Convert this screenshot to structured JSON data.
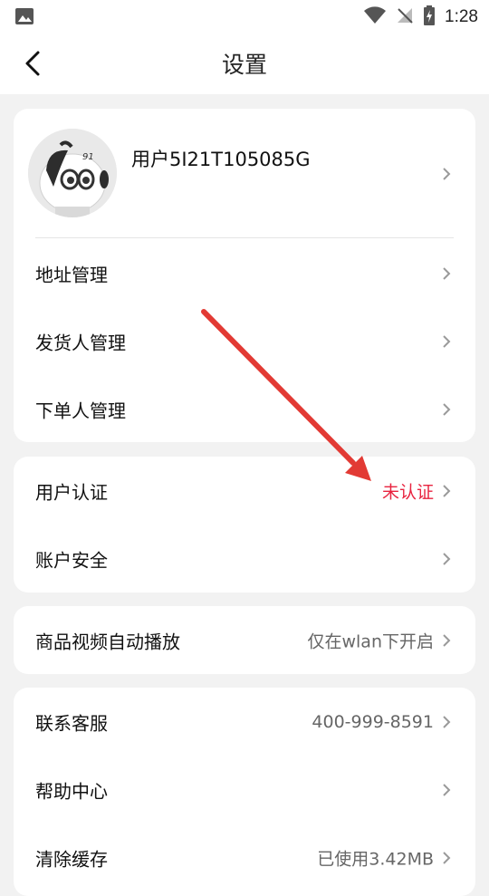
{
  "status_bar": {
    "time": "1:28"
  },
  "header": {
    "title": "设置"
  },
  "profile": {
    "username": "用户5I21T105085G",
    "avatar_badge": "91"
  },
  "group1": [
    {
      "label": "地址管理"
    },
    {
      "label": "发货人管理"
    },
    {
      "label": "下单人管理"
    }
  ],
  "group2": [
    {
      "label": "用户认证",
      "value": "未认证"
    },
    {
      "label": "账户安全"
    }
  ],
  "group3": [
    {
      "label": "商品视频自动播放",
      "value": "仅在wlan下开启"
    }
  ],
  "group4": [
    {
      "label": "联系客服",
      "value": "400-999-8591"
    },
    {
      "label": "帮助中心"
    },
    {
      "label": "清除缓存",
      "value": "已使用3.42MB"
    }
  ],
  "colors": {
    "accent_red": "#e8233f",
    "annotation_arrow": "#e23a34"
  }
}
